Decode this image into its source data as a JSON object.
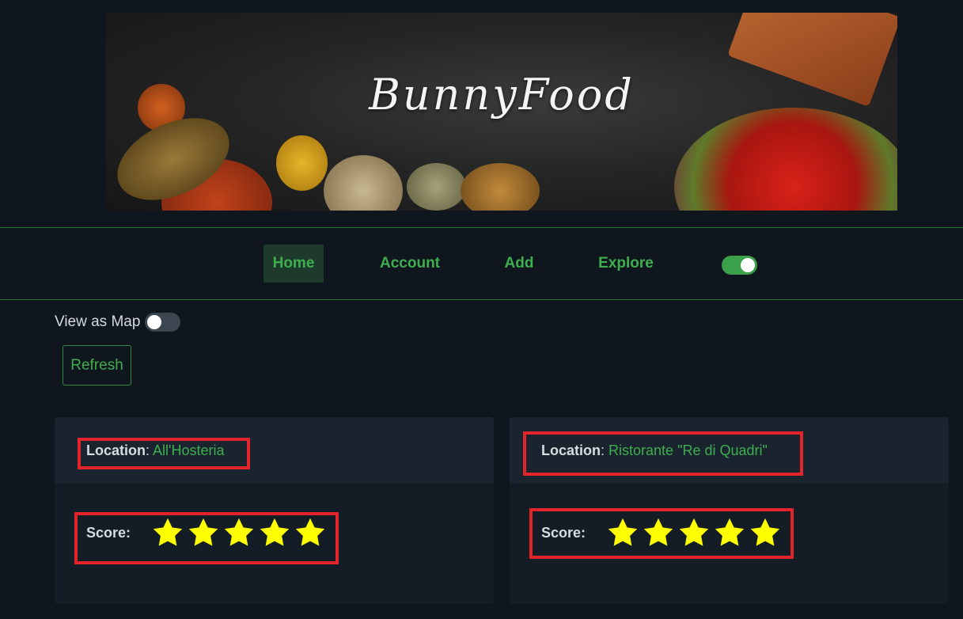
{
  "banner": {
    "title": "BunnyFood"
  },
  "nav": {
    "items": [
      {
        "label": "Home"
      },
      {
        "label": "Account"
      },
      {
        "label": "Add"
      },
      {
        "label": "Explore"
      }
    ],
    "theme_toggle_on": true
  },
  "controls": {
    "map_label": "View as Map",
    "map_toggle_on": false,
    "refresh_label": "Refresh"
  },
  "cards": [
    {
      "location_key": "Location",
      "location_sep": ":",
      "location_value": "All'Hosteria",
      "score_key": "Score:",
      "rating": 5
    },
    {
      "location_key": "Location",
      "location_sep": ":",
      "location_value": "Ristorante \"Re di Quadri\"",
      "score_key": "Score:",
      "rating": 5
    }
  ],
  "colors": {
    "accent": "#3fae4f",
    "star": "#ffff00",
    "highlight": "#e3242b",
    "background": "#0f161d"
  }
}
